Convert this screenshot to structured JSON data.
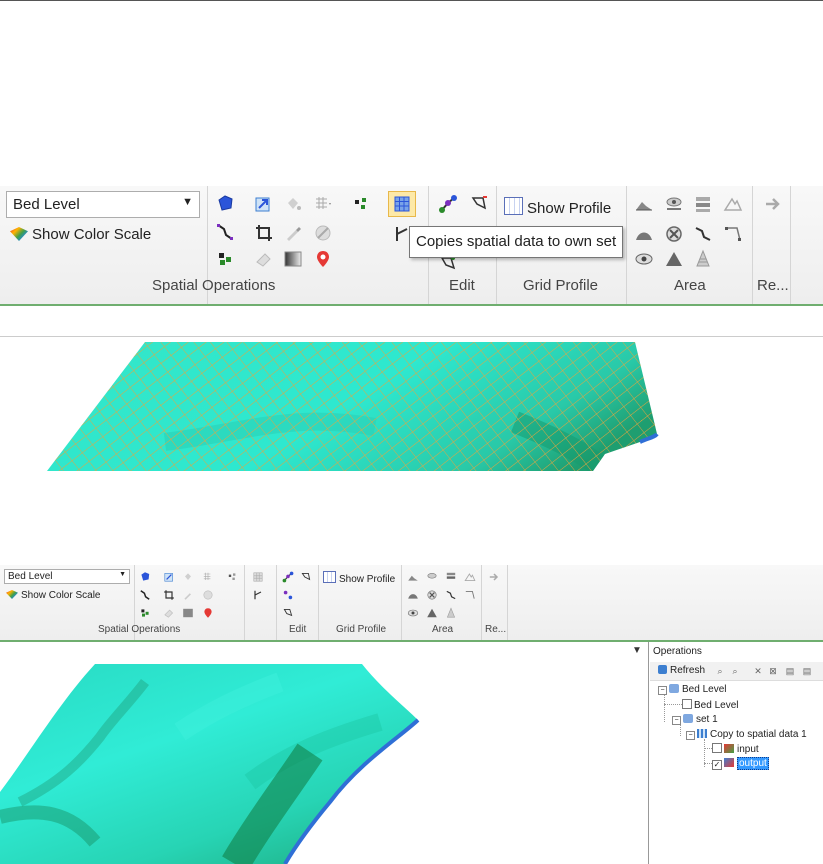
{
  "ribbon_large": {
    "dataset_combo": "Bed Level",
    "show_color_scale": "Show Color Scale",
    "show_profile": "Show Profile",
    "tooltip": "Copies spatial data to own set",
    "groups": {
      "spatial_operations": "Spatial Operations",
      "edit": "Edit",
      "grid_profile": "Grid Profile",
      "area": "Area",
      "re": "Re..."
    }
  },
  "ribbon_small": {
    "dataset_combo": "Bed Level",
    "show_color_scale": "Show Color Scale",
    "show_profile": "Show Profile",
    "groups": {
      "spatial_operations": "Spatial Operations",
      "edit": "Edit",
      "grid_profile": "Grid Profile",
      "area": "Area",
      "re": "Re..."
    }
  },
  "operations_panel": {
    "title": "Operations",
    "refresh": "Refresh",
    "tree": {
      "root": "Bed Level",
      "root_child": "Bed Level",
      "set": "set 1",
      "operation": "Copy to spatial data 1",
      "input": "input",
      "output": "output"
    }
  },
  "colors": {
    "ribbon_accent": "#6fae6f",
    "bathymetry_cyan": "#2ee8cf",
    "grid_lines": "#e8a43c",
    "selection": "#3399ff"
  }
}
